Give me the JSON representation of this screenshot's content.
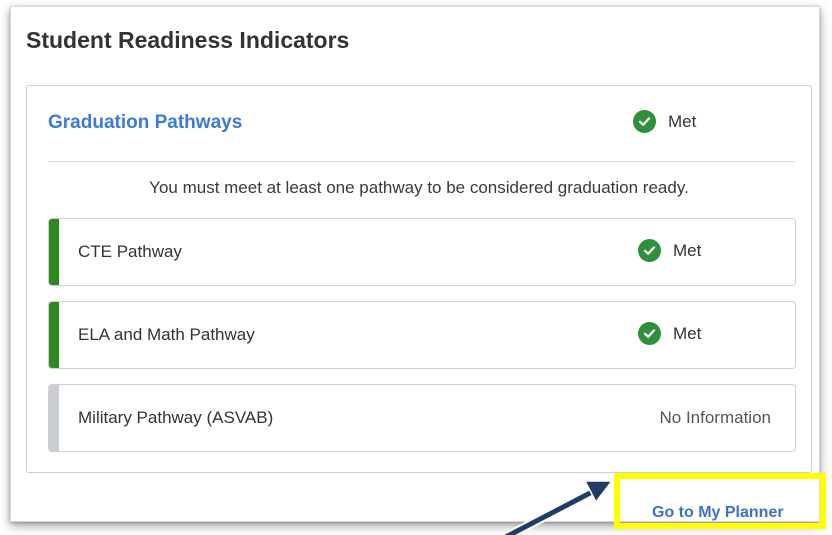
{
  "card": {
    "title": "Student Readiness Indicators"
  },
  "section": {
    "title": "Graduation Pathways",
    "status_label": "Met",
    "status_icon": "check-circle-icon",
    "note": "You must meet at least one pathway to be considered graduation ready."
  },
  "pathways": [
    {
      "label": "CTE Pathway",
      "status": "Met",
      "state": "met"
    },
    {
      "label": "ELA and Math Pathway",
      "status": "Met",
      "state": "met"
    },
    {
      "label": "Military Pathway (ASVAB)",
      "status": "No Information",
      "state": "none"
    }
  ],
  "footer": {
    "link_label": "Go to My Planner"
  },
  "colors": {
    "met_green": "#2f8f3a",
    "bar_green": "#2f8a1e",
    "bar_grey": "#c9cdd1",
    "link_blue": "#3b6fd0",
    "highlight_yellow": "#ffff00",
    "arrow_navy": "#1f3d66"
  }
}
